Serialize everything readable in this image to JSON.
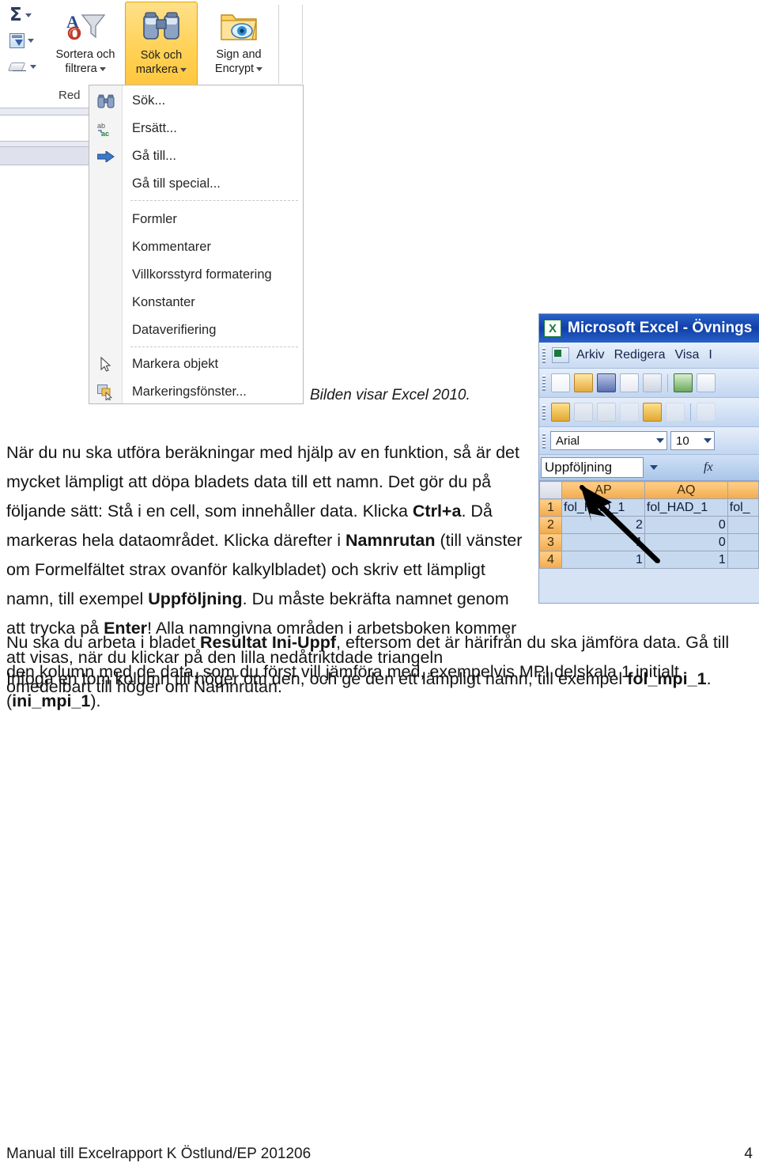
{
  "ribbon": {
    "small_items": [
      {
        "name": "autosum",
        "glyph": "Σ"
      },
      {
        "name": "fill",
        "glyph": ""
      },
      {
        "name": "clear",
        "glyph": ""
      }
    ],
    "groups": [
      {
        "label_line1": "Sortera och",
        "label_line2": "filtrera",
        "icon": "sort-filter-icon"
      },
      {
        "label_line1": "Sök och",
        "label_line2": "markera",
        "icon": "binoculars-icon"
      },
      {
        "label_line1": "Sign and",
        "label_line2": "Encrypt",
        "icon": "sign-encrypt-icon"
      }
    ],
    "group_label_partial": "Red",
    "highlight_color": "#ffd257"
  },
  "menu": {
    "items": [
      {
        "label": "Sök...",
        "icon": "binoculars-icon"
      },
      {
        "label": "Ersätt...",
        "icon": "replace-icon"
      },
      {
        "label": "Gå till...",
        "icon": "goto-arrow-icon"
      },
      {
        "label": "Gå till special...",
        "icon": "none"
      },
      {
        "label": "Formler",
        "icon": "none"
      },
      {
        "label": "Kommentarer",
        "icon": "none"
      },
      {
        "label": "Villkorsstyrd formatering",
        "icon": "none"
      },
      {
        "label": "Konstanter",
        "icon": "none"
      },
      {
        "label": "Dataverifiering",
        "icon": "none"
      },
      {
        "label": "Markera objekt",
        "icon": "pointer-icon"
      },
      {
        "label": "Markeringsfönster...",
        "icon": "selection-pane-icon"
      }
    ]
  },
  "caption": "Bilden visar Excel 2010.",
  "excel2003": {
    "title": "Microsoft Excel - Övnings",
    "menus": [
      "Arkiv",
      "Redigera",
      "Visa",
      "I"
    ],
    "font_name": "Arial",
    "font_size": "10",
    "name_box": "Uppföljning",
    "formula_icon": "fx",
    "columns": [
      "AP",
      "AQ"
    ],
    "rows": [
      {
        "num": "1",
        "cells": [
          "fol_HAD_1",
          "fol_HAD_1",
          "fol_"
        ]
      },
      {
        "num": "2",
        "cells": [
          "2",
          "0",
          ""
        ]
      },
      {
        "num": "3",
        "cells": [
          "1",
          "0",
          ""
        ]
      },
      {
        "num": "4",
        "cells": [
          "1",
          "1",
          ""
        ]
      }
    ]
  },
  "paragraphs": {
    "p1": {
      "seg1": "När du nu ska utföra beräkningar med hjälp av en funktion, så är det mycket lämpligt att döpa bladets data till ett namn. Det gör du på följande sätt: Stå i en cell, som innehåller data. Klicka ",
      "b1": "Ctrl+a",
      "seg2": ". Då markeras hela dataområdet. Klicka därefter i ",
      "b2": "Namnrutan",
      "seg3": " (till vänster om Formelfältet strax ovanför kalkylbladet) och skriv ett lämpligt namn, till exempel ",
      "b3": "Uppföljning",
      "seg4": ". Du måste bekräfta namnet genom att trycka på ",
      "b4": "Enter",
      "seg5": "! Alla namngivna områden i arbetsboken kommer att visas, när du klickar på den lilla nedåtriktdade triangeln omedelbart till höger om Namnrutan."
    },
    "p2": {
      "seg1": "Nu ska du arbeta i bladet ",
      "b1": "Resultat Ini-Uppf",
      "seg2": ", eftersom det är härifrån du ska jämföra data. Gå till den kolumn med de data, som du först vill jämföra med, exempelvis MPI delskala 1 initialt (",
      "b2": "ini_mpi_1",
      "seg3": ")."
    },
    "p3": {
      "seg1": "Infoga en tom kolumn till höger om den, och ge den ett lämpligt namn, till exempel ",
      "b1": "fol_mpi_1",
      "seg2": "."
    }
  },
  "footer": {
    "left": "Manual till Excelrapport K Östlund/EP 201206",
    "page": "4"
  }
}
